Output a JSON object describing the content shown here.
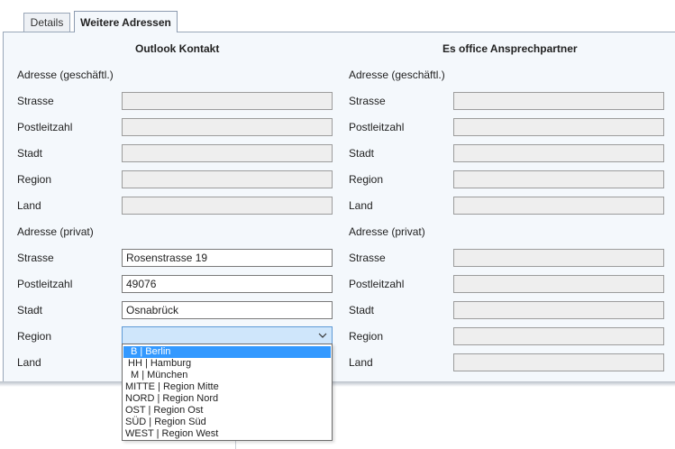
{
  "tabs": [
    {
      "label": "Details"
    },
    {
      "label": "Weitere Adressen"
    }
  ],
  "left": {
    "title": "Outlook Kontakt",
    "business_header": "Adresse (geschäftl.)",
    "business": {
      "strasse_label": "Strasse",
      "strasse": "",
      "plz_label": "Postleitzahl",
      "plz": "",
      "stadt_label": "Stadt",
      "stadt": "",
      "region_label": "Region",
      "region": "",
      "land_label": "Land",
      "land": ""
    },
    "private_header": "Adresse (privat)",
    "private": {
      "strasse_label": "Strasse",
      "strasse": "Rosenstrasse 19",
      "plz_label": "Postleitzahl",
      "plz": "49076",
      "stadt_label": "Stadt",
      "stadt": "Osnabrück",
      "region_label": "Region",
      "region": "",
      "land_label": "Land"
    }
  },
  "right": {
    "title": "Es office Ansprechpartner",
    "business_header": "Adresse (geschäftl.)",
    "business": {
      "strasse_label": "Strasse",
      "strasse": "",
      "plz_label": "Postleitzahl",
      "plz": "",
      "stadt_label": "Stadt",
      "stadt": "",
      "region_label": "Region",
      "region": "",
      "land_label": "Land",
      "land": ""
    },
    "private_header": "Adresse (privat)",
    "private": {
      "strasse_label": "Strasse",
      "strasse": "",
      "plz_label": "Postleitzahl",
      "plz": "",
      "stadt_label": "Stadt",
      "stadt": "",
      "region_label": "Region",
      "region": "",
      "land_label": "Land",
      "land": ""
    }
  },
  "region_dropdown": {
    "options": [
      "B | Berlin",
      "HH | Hamburg",
      "M | München",
      "MITTE | Region Mitte",
      "NORD | Region Nord",
      "OST | Region Ost",
      "SÜD | Region Süd",
      "WEST | Region West"
    ],
    "selected_index": 0
  },
  "colors": {
    "selection": "#3399ff",
    "panel_bg": "#f4f8fc",
    "combo_bg": "#cfe6fb"
  }
}
